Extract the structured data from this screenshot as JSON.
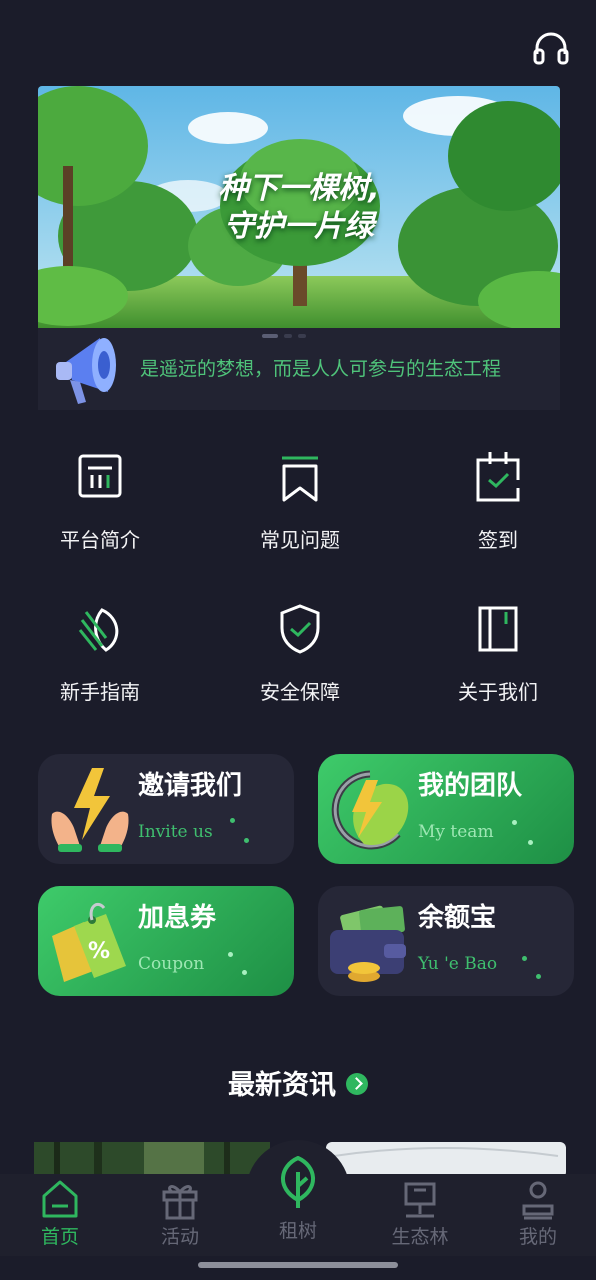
{
  "header": {
    "support_icon": "headset-icon"
  },
  "banner": {
    "title_line1": "种下一棵树,",
    "title_line2": "守护一片绿",
    "page_count": 3,
    "active_page": 1
  },
  "notice": {
    "icon": "megaphone-icon",
    "text": "是遥远的梦想，而是人人可参与的生态工程"
  },
  "menu": [
    {
      "label": "平台简介",
      "icon": "platform-intro-icon"
    },
    {
      "label": "常见问题",
      "icon": "bookmark-icon"
    },
    {
      "label": "签到",
      "icon": "check-in-icon"
    },
    {
      "label": "新手指南",
      "icon": "leaf-guide-icon"
    },
    {
      "label": "安全保障",
      "icon": "shield-check-icon"
    },
    {
      "label": "关于我们",
      "icon": "about-book-icon"
    }
  ],
  "cards": [
    {
      "title": "邀请我们",
      "subtitle": "Invite us",
      "icon": "invite-hands-lightning-icon"
    },
    {
      "title": "我的团队",
      "subtitle": "My team",
      "icon": "team-leaf-lightning-icon"
    },
    {
      "title": "加息券",
      "subtitle": "Coupon",
      "icon": "coupon-tag-icon"
    },
    {
      "title": "余额宝",
      "subtitle": "Yu 'e Bao",
      "icon": "wallet-money-icon"
    }
  ],
  "news": {
    "heading": "最新资讯"
  },
  "tabbar": [
    {
      "label": "首页",
      "icon": "home-icon",
      "active": true
    },
    {
      "label": "活动",
      "icon": "gift-icon",
      "active": false
    },
    {
      "label": "租树",
      "icon": "tree-icon",
      "active": false
    },
    {
      "label": "生态林",
      "icon": "forest-board-icon",
      "active": false
    },
    {
      "label": "我的",
      "icon": "profile-icon",
      "active": false
    }
  ],
  "colors": {
    "accent": "#2fb75f",
    "background": "#1b1c2a",
    "card_dark": "#262737"
  }
}
